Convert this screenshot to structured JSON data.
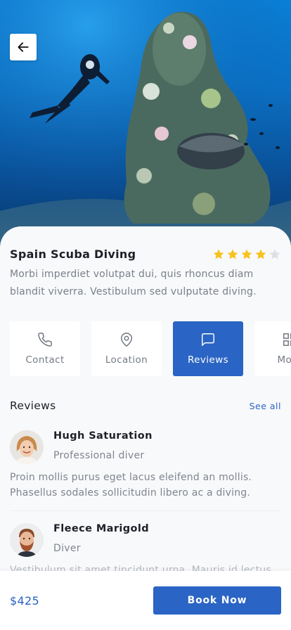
{
  "header": {
    "back_icon": "arrow-left-icon"
  },
  "trip": {
    "title": "Spain Scuba Diving",
    "rating": 4,
    "rating_max": 5,
    "description": "Morbi imperdiet volutpat dui, quis rhoncus diam blandit viverra. Vestibulum sed vulputate diving."
  },
  "tabs": [
    {
      "label": "Contact",
      "icon": "phone-icon",
      "active": false
    },
    {
      "label": "Location",
      "icon": "map-pin-icon",
      "active": false
    },
    {
      "label": "Reviews",
      "icon": "message-square-icon",
      "active": true
    },
    {
      "label": "More",
      "icon": "grid-icon",
      "active": false
    }
  ],
  "reviews": {
    "title": "Reviews",
    "see_all": "See all",
    "items": [
      {
        "name": "Hugh Saturation",
        "role": "Professional diver",
        "text": "Proin mollis purus eget lacus eleifend an mollis. Phasellus sodales sollicitudin libero ac a diving."
      },
      {
        "name": "Fleece Marigold",
        "role": "Diver",
        "text": "Vestibulum sit amet tincidunt urna. Mauris id lectus diving."
      }
    ]
  },
  "footer": {
    "price": "$425",
    "book_label": "Book Now"
  },
  "colors": {
    "accent": "#2a64c4",
    "star": "#f7c21b",
    "star_empty": "#dcdfe4"
  }
}
